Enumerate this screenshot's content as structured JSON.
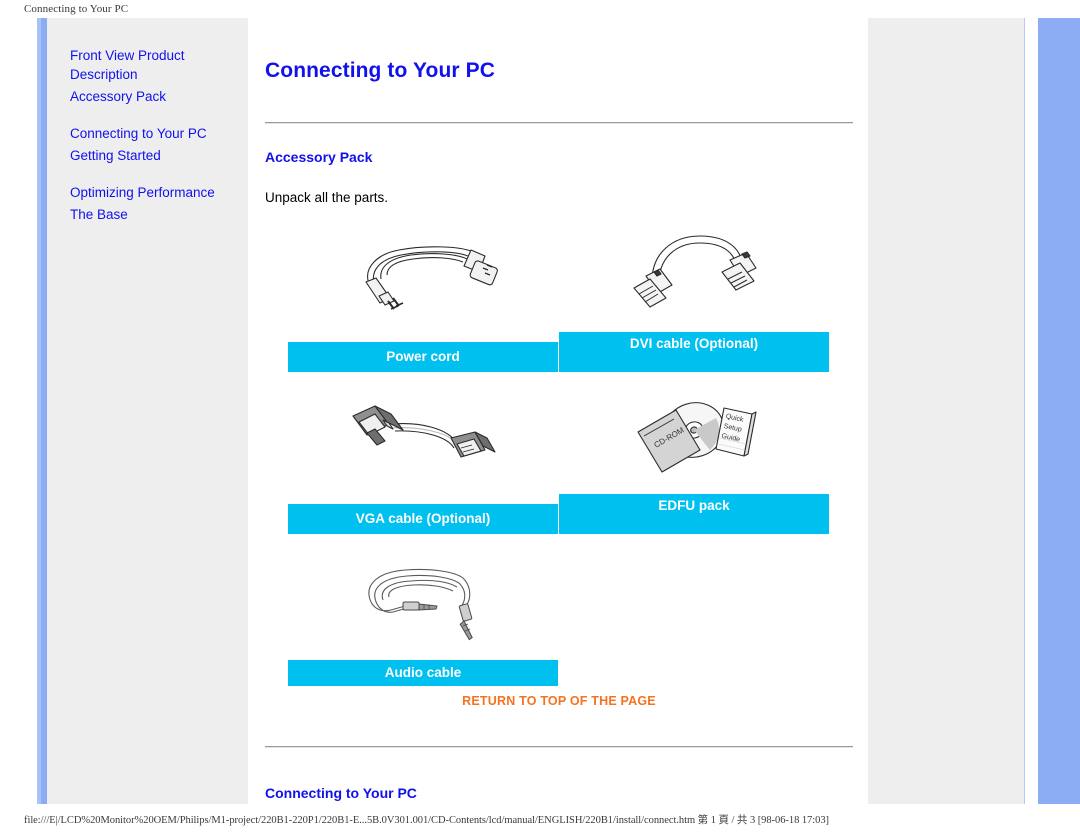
{
  "browser": {
    "header_title": "Connecting to Your PC",
    "footer_text": "file:///E|/LCD%20Monitor%20OEM/Philips/M1-project/220B1-220P1/220B1-E...5B.0V301.001/CD-Contents/lcd/manual/ENGLISH/220B1/install/connect.htm 第 1 頁 / 共 3 [98-06-18 17:03]"
  },
  "sidebar": {
    "groups": [
      {
        "items": [
          {
            "label": "Front View Product Description"
          },
          {
            "label": "Accessory Pack"
          }
        ]
      },
      {
        "items": [
          {
            "label": "Connecting to Your PC"
          },
          {
            "label": "Getting Started"
          }
        ]
      },
      {
        "items": [
          {
            "label": "Optimizing Performance"
          },
          {
            "label": "The Base"
          }
        ]
      }
    ]
  },
  "main": {
    "page_title": "Connecting to Your PC",
    "section_accessory_title": "Accessory Pack",
    "intro_paragraph": "Unpack all the parts.",
    "return_to_top_label": "RETURN TO TOP OF THE PAGE",
    "section_connecting_title": "Connecting to Your PC",
    "accessories": [
      {
        "label": "Power cord",
        "icon": "power-cord-illustration"
      },
      {
        "label": "DVI cable (Optional)",
        "icon": "dvi-cable-illustration"
      },
      {
        "label": "VGA cable (Optional)",
        "icon": "vga-cable-illustration"
      },
      {
        "label": "EDFU pack",
        "icon": "edfu-pack-illustration"
      },
      {
        "label": "Audio cable",
        "icon": "audio-cable-illustration"
      }
    ],
    "edfu_art_text": {
      "disc_sleeve": "CD-ROM",
      "booklet_line1": "Quick",
      "booklet_line2": "Setup",
      "booklet_line3": "Guide"
    }
  },
  "colors": {
    "link_blue": "#1111ee",
    "label_cyan": "#00c0f0",
    "return_orange": "#f47321",
    "panel_grey": "#eeeeee",
    "accent_blue": "#8cadf4"
  }
}
